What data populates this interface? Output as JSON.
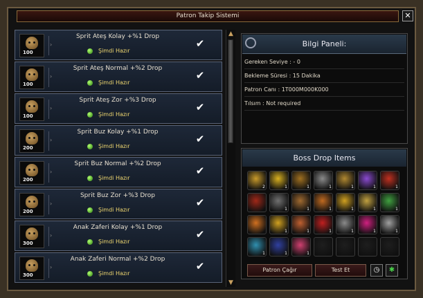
{
  "window": {
    "title": "Patron Takip Sistemi",
    "close_label": "✕"
  },
  "bosses": [
    {
      "name": "Sprit Ateş Kolay +%1 Drop",
      "level": "100",
      "status": "Şimdi Hazır"
    },
    {
      "name": "Sprit Ateş Normal +%2 Drop",
      "level": "100",
      "status": "Şimdi Hazır"
    },
    {
      "name": "Sprit Ateş Zor +%3 Drop",
      "level": "100",
      "status": "Şimdi Hazır"
    },
    {
      "name": "Sprit Buz Kolay +%1 Drop",
      "level": "200",
      "status": "Şimdi Hazır"
    },
    {
      "name": "Sprit Buz Normal +%2 Drop",
      "level": "200",
      "status": "Şimdi Hazır"
    },
    {
      "name": "Sprit Buz Zor +%3 Drop",
      "level": "200",
      "status": "Şimdi Hazır"
    },
    {
      "name": "Anak Zaferi Kolay +%1 Drop",
      "level": "300",
      "status": "Şimdi Hazır"
    },
    {
      "name": "Anak Zaferi Normal +%2 Drop",
      "level": "300",
      "status": "Şimdi Hazır"
    }
  ],
  "info_panel": {
    "title": "Bilgi Paneli:",
    "lines": [
      "Gereken Seviye : - 0",
      "Bekleme Süresi : 15 Dakika",
      "Patron Canı : 1T000M000K000",
      "Tılsım : Not required"
    ]
  },
  "drops": {
    "title": "Boss Drop Items",
    "items": [
      {
        "icon": "star-relic-icon",
        "color": "#c89a2a",
        "count": "2"
      },
      {
        "icon": "gold-pouch-icon",
        "color": "#d8b020",
        "count": "1"
      },
      {
        "icon": "treasure-chest-icon",
        "color": "#a07020",
        "count": "1"
      },
      {
        "icon": "helmet-icon",
        "color": "#8a8a8a",
        "count": "1"
      },
      {
        "icon": "gold-chest-icon",
        "color": "#b08830",
        "count": "1"
      },
      {
        "icon": "purple-gem-icon",
        "color": "#8a4ad0",
        "count": "1"
      },
      {
        "icon": "red-orb-icon",
        "color": "#c03020",
        "count": "1"
      },
      {
        "icon": "red-scroll-icon",
        "color": "#a02818",
        "count": ""
      },
      {
        "icon": "book-icon",
        "color": "#707070",
        "count": "1"
      },
      {
        "icon": "bag-icon",
        "color": "#a06a30",
        "count": "1"
      },
      {
        "icon": "beast-head-icon",
        "color": "#c06a20",
        "count": "1"
      },
      {
        "icon": "gold-armor-icon",
        "color": "#d0a020",
        "count": "1"
      },
      {
        "icon": "pet-icon",
        "color": "#c0a040",
        "count": "1"
      },
      {
        "icon": "wing-icon",
        "color": "#40a040",
        "count": "1"
      },
      {
        "icon": "flame-sword-icon",
        "color": "#d07020",
        "count": ""
      },
      {
        "icon": "gold-armor-icon",
        "color": "#d0a020",
        "count": "1"
      },
      {
        "icon": "fire-armor-icon",
        "color": "#c06030",
        "count": "1"
      },
      {
        "icon": "red-armor-icon",
        "color": "#c02020",
        "count": "1"
      },
      {
        "icon": "cross-shield-icon",
        "color": "#8a8a8a",
        "count": "1"
      },
      {
        "icon": "pink-gem-icon",
        "color": "#d02080",
        "count": "1"
      },
      {
        "icon": "silver-glove-icon",
        "color": "#a0a0a0",
        "count": "1"
      },
      {
        "icon": "blue-dragon-icon",
        "color": "#3090b0",
        "count": "1"
      },
      {
        "icon": "blue-pet-icon",
        "color": "#3040a0",
        "count": "1"
      },
      {
        "icon": "pink-ring-icon",
        "color": "#d04070",
        "count": "1"
      },
      {
        "icon": "empty-slot-icon",
        "color": "#1e1e1e",
        "count": ""
      },
      {
        "icon": "empty-slot-icon",
        "color": "#1e1e1e",
        "count": ""
      },
      {
        "icon": "empty-slot-icon",
        "color": "#1e1e1e",
        "count": ""
      },
      {
        "icon": "empty-slot-icon",
        "color": "#1e1e1e",
        "count": ""
      }
    ]
  },
  "buttons": {
    "call": "Patron Çağır",
    "test": "Test Et"
  }
}
